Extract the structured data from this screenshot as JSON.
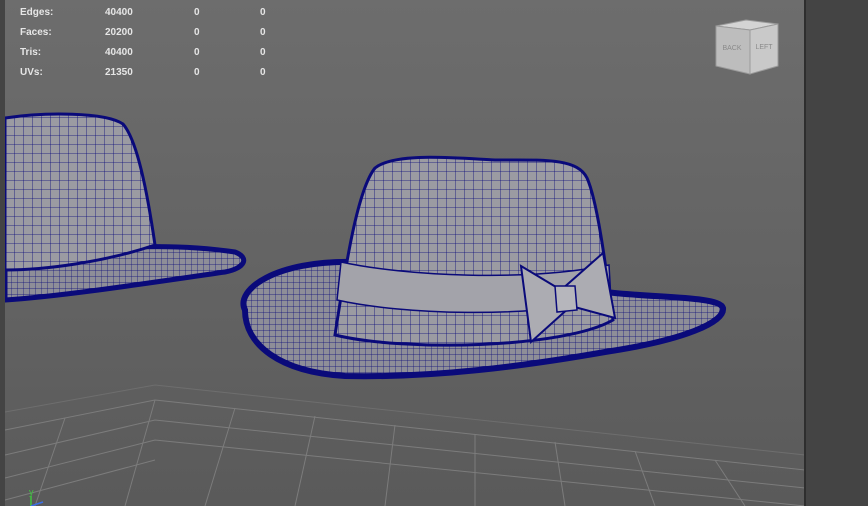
{
  "hud": {
    "rows": [
      {
        "label": "Edges:",
        "value": "40400",
        "c1": "0",
        "c2": "0"
      },
      {
        "label": "Faces:",
        "value": "20200",
        "c1": "0",
        "c2": "0"
      },
      {
        "label": "Tris:",
        "value": "40400",
        "c1": "0",
        "c2": "0"
      },
      {
        "label": "UVs:",
        "value": "21350",
        "c1": "0",
        "c2": "0"
      }
    ]
  },
  "viewcube": {
    "back_label": "BACK",
    "left_label": "LEFT"
  },
  "axis": {
    "y_label": "y"
  },
  "colors": {
    "wire": "#0a0a7a",
    "mesh_face": "#9a9aa0",
    "grid": "#7a7a7a",
    "hud_text": "#e6e6e6"
  }
}
